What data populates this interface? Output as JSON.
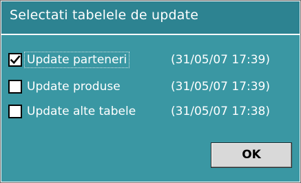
{
  "dialog": {
    "title": "Selectati tabelele de update"
  },
  "items": [
    {
      "label": "Update parteneri",
      "timestamp": "(31/05/07 17:39)",
      "checked": true
    },
    {
      "label": "Update produse",
      "timestamp": "(31/05/07 17:39)",
      "checked": false
    },
    {
      "label": "Update alte tabele",
      "timestamp": "(31/05/07 17:38)",
      "checked": false
    }
  ],
  "buttons": {
    "ok_label": "OK"
  },
  "colors": {
    "title_bar": "#2d8391",
    "body": "#3a97a3",
    "button": "#d9d9d9"
  }
}
